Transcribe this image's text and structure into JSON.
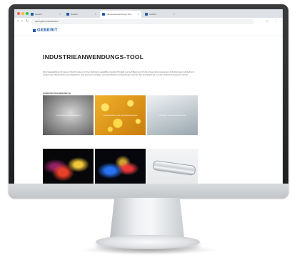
{
  "browser": {
    "window_dot_colors": [
      "#ff5f57",
      "#febc2e",
      "#28c840"
    ],
    "tabs": [
      {
        "label": "Geberit",
        "active": false
      },
      {
        "label": "Geberit",
        "active": false
      },
      {
        "label": "Industrieanwendungs-Tool",
        "active": true
      },
      {
        "label": "Geberit",
        "active": false
      }
    ],
    "tab_close": "×",
    "url": "www.geberit.de/industrie"
  },
  "brand": {
    "logo_text": "GEBERIT",
    "accent_color": "#1f5aa6"
  },
  "page": {
    "title": "INDUSTRIEANWENDUNGS-TOOL",
    "intro": "Die Fragestellung mit diesem Tool für das von Ihnen definierte gewählten Geberit Produkt und auf Basis der für die Anwendung relevanten Anforderungen schnell und einfach die Übereinstimmung abgleichen. Die weiteren Anfragen und spezifischen Anwendungen werden Sie anschließend von den Geberit Kompetenz Center.",
    "section_label": "ANWENDUNGSBEREICH"
  },
  "tiles": [
    {
      "label": "Chemikalienbeständigkeit"
    },
    {
      "label": "Lebensmittel- und Getränkeindustrie"
    },
    {
      "label": "Pharma- und Medizintechnik"
    },
    {
      "label": ""
    },
    {
      "label": ""
    },
    {
      "label": ""
    }
  ]
}
